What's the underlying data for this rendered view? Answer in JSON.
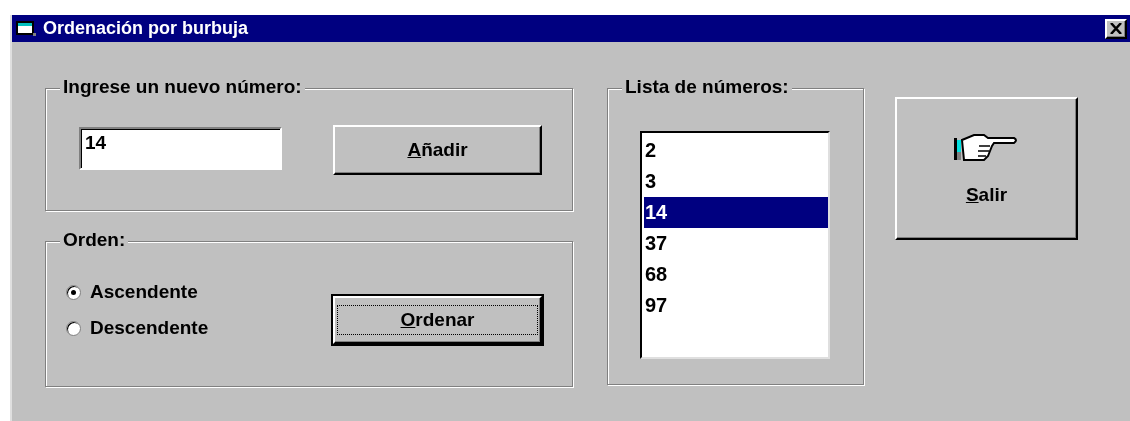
{
  "window": {
    "title": "Ordenación por burbuja"
  },
  "input_group": {
    "title": "Ingrese un nuevo número:",
    "field": {
      "value": "14"
    },
    "button": {
      "label": "Añadir",
      "underline_first": true,
      "focused": false
    }
  },
  "order_group": {
    "title": "Orden:",
    "options": [
      {
        "label": "Ascendente",
        "selected": true
      },
      {
        "label": "Descendente",
        "selected": false
      }
    ],
    "button": {
      "label": "Ordenar",
      "underline_first": true,
      "focused": true
    }
  },
  "list_group": {
    "title": "Lista de números:",
    "items": [
      {
        "label": "2",
        "selected": false
      },
      {
        "label": "3",
        "selected": false
      },
      {
        "label": "14",
        "selected": true
      },
      {
        "label": "37",
        "selected": false
      },
      {
        "label": "68",
        "selected": false
      },
      {
        "label": "97",
        "selected": false
      }
    ]
  },
  "exit_button": {
    "label": "Salir",
    "underline_first": true,
    "focused": false
  }
}
